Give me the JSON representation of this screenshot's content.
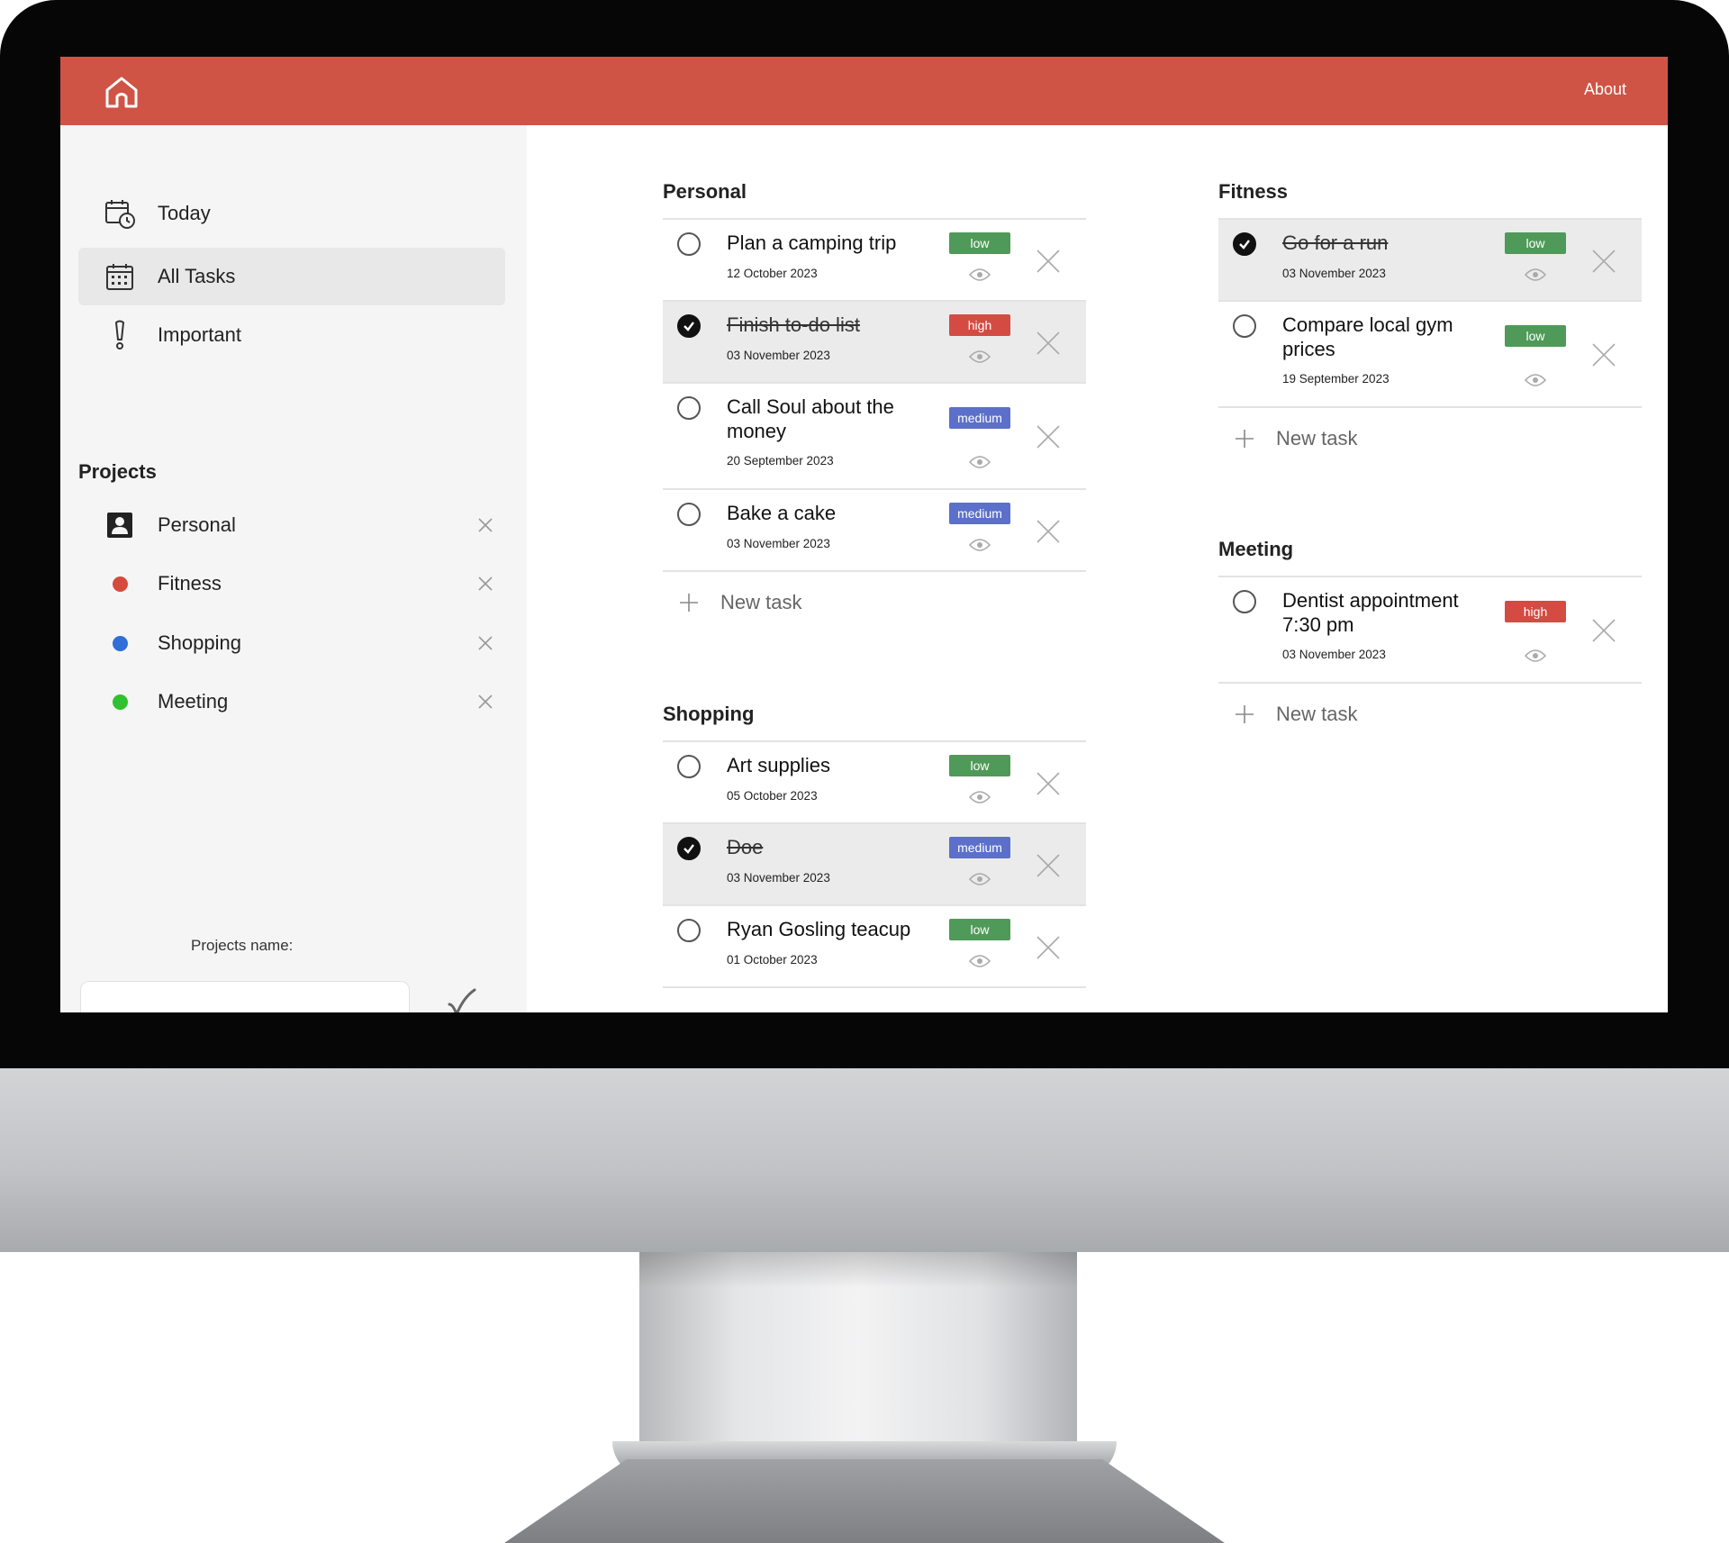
{
  "header": {
    "home_icon": "home-icon",
    "about_label": "About",
    "bar_color": "#cf5445"
  },
  "sidebar": {
    "nav": [
      {
        "label": "Today",
        "icon": "calendar-clock-icon",
        "active": false
      },
      {
        "label": "All Tasks",
        "icon": "calendar-grid-icon",
        "active": true
      },
      {
        "label": "Important",
        "icon": "exclamation-icon",
        "active": false
      }
    ],
    "projects_title": "Projects",
    "projects": [
      {
        "label": "Personal",
        "icon": "contact-card-icon",
        "color": "#222222"
      },
      {
        "label": "Fitness",
        "icon": "dot",
        "color": "#d64a3e"
      },
      {
        "label": "Shopping",
        "icon": "dot",
        "color": "#2f6fd6"
      },
      {
        "label": "Meeting",
        "icon": "dot",
        "color": "#2fc12f"
      }
    ],
    "project_name_label": "Projects name:",
    "project_name_value": "",
    "picker": [
      {
        "type": "color",
        "value": "#333333"
      },
      {
        "type": "color",
        "value": "#2f6fd6"
      },
      {
        "type": "color",
        "value": "#2fc12f"
      },
      {
        "type": "color",
        "value": "#d64a3e"
      },
      {
        "type": "color",
        "value": "#e8d24a"
      },
      {
        "type": "icon",
        "value": "bookmark-icon"
      },
      {
        "type": "icon",
        "value": "clock-icon"
      },
      {
        "type": "icon",
        "value": "exclamation-icon"
      },
      {
        "type": "icon",
        "value": "user-check-icon"
      },
      {
        "type": "icon",
        "value": "contact-card-icon"
      }
    ]
  },
  "sections": [
    {
      "title": "Personal",
      "tasks": [
        {
          "title": "Plan a camping trip",
          "date": "12 October 2023",
          "priority": "low",
          "done": false
        },
        {
          "title": "Finish to-do list",
          "date": "03 November 2023",
          "priority": "high",
          "done": true
        },
        {
          "title": "Call Soul about the money",
          "date": "20 September 2023",
          "priority": "medium",
          "done": false
        },
        {
          "title": "Bake a cake",
          "date": "03 November 2023",
          "priority": "medium",
          "done": false
        }
      ],
      "new_task_label": "New task"
    },
    {
      "title": "Shopping",
      "tasks": [
        {
          "title": "Art supplies",
          "date": "05 October 2023",
          "priority": "low",
          "done": false
        },
        {
          "title": "Doe",
          "date": "03 November 2023",
          "priority": "medium",
          "done": true
        },
        {
          "title": "Ryan Gosling teacup",
          "date": "01 October 2023",
          "priority": "low",
          "done": false
        }
      ]
    },
    {
      "title": "Fitness",
      "tasks": [
        {
          "title": "Go for a run",
          "date": "03 November 2023",
          "priority": "low",
          "done": true
        },
        {
          "title": "Compare local gym prices",
          "date": "19 September 2023",
          "priority": "low",
          "done": false
        }
      ],
      "new_task_label": "New task"
    },
    {
      "title": "Meeting",
      "tasks": [
        {
          "title": "Dentist appointment 7:30 pm",
          "date": "03 November 2023",
          "priority": "high",
          "done": false
        }
      ],
      "new_task_label": "New task"
    }
  ]
}
